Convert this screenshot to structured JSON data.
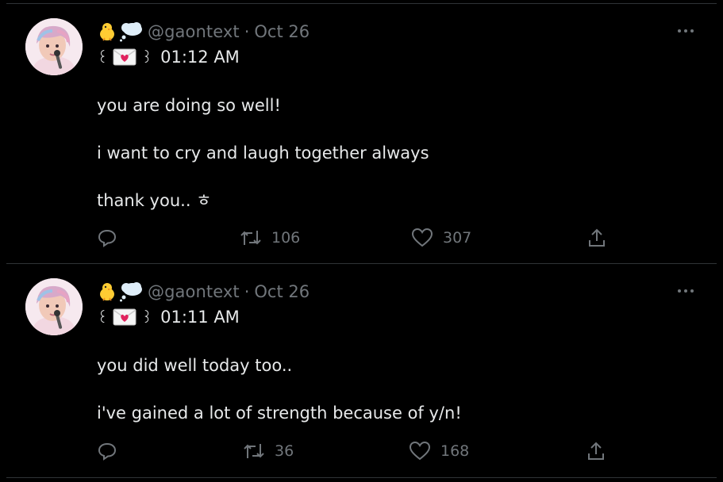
{
  "tweets": [
    {
      "handle": "@gaontext",
      "separator": "·",
      "date": "Oct 26",
      "paren_left": "꒰",
      "paren_right": "꒱",
      "time": "01:12 AM",
      "lines": [
        "you are doing so well!",
        "i want to cry and laugh together always",
        "thank you.. ㅎ"
      ],
      "retweets": "106",
      "likes": "307"
    },
    {
      "handle": "@gaontext",
      "separator": "·",
      "date": "Oct 26",
      "paren_left": "꒰",
      "paren_right": "꒱",
      "time": "01:11 AM",
      "lines": [
        "you did well today too..",
        "i've gained a lot of strength because of y/n!"
      ],
      "retweets": "36",
      "likes": "168"
    }
  ],
  "colors": {
    "background": "#000000",
    "text": "#e7e9ea",
    "muted": "#71767b",
    "divider": "#2f3336"
  },
  "icons": [
    "chick-emoji",
    "thought-bubble-emoji",
    "love-letter-emoji",
    "more-icon",
    "reply-icon",
    "retweet-icon",
    "like-icon",
    "share-icon"
  ]
}
